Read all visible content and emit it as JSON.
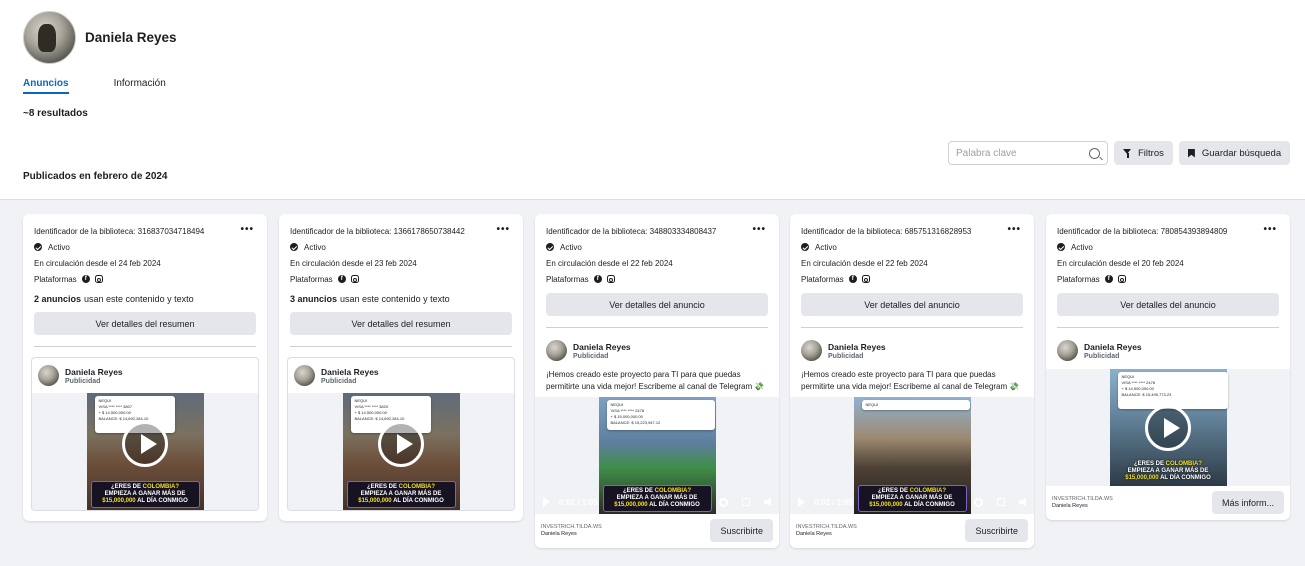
{
  "page": {
    "name": "Daniela Reyes"
  },
  "tabs": [
    {
      "label": "Anuncios",
      "active": true
    },
    {
      "label": "Información",
      "active": false
    }
  ],
  "results": "~8 resultados",
  "toolbar": {
    "search_placeholder": "Palabra clave",
    "filters_label": "Filtros",
    "save_search_label": "Guardar búsqueda"
  },
  "section_title": "Publicados en febrero de 2024",
  "labels": {
    "active": "Activo",
    "platforms": "Plataformas",
    "sponsored": "Publicidad"
  },
  "colors": {
    "accent": "#0a66c2",
    "promo_yellow": "#f3e01a",
    "card_bg": "#ffffff",
    "area_bg": "#f0f2f5"
  },
  "ad_text": "¡Hemos creado este proyecto para TI para que puedas permitirte una vida mejor! Escribeme al canal de Telegram 💸",
  "promo": {
    "line1a": "¿ERES DE ",
    "line1b": "COLOMBIA?",
    "line2": "EMPIEZA A GANAR MÁS DE",
    "amount": "$15,000,000",
    "line3": " AL DÍA CONMIGO"
  },
  "cards": [
    {
      "library_id": "Identificador de la biblioteca: 316837034718494",
      "since": "En circulación desde el 24 feb 2024",
      "multi_count": "2 anuncios",
      "multi_text": "usan este contenido y texto",
      "detail_button": "Ver detalles del resumen",
      "advertiser": "Daniela Reyes",
      "bank": [
        "NEQUI",
        "VISA **** **** 3807",
        "+ $ 14,500,000.00",
        "BALANCE: $ 14,692,284.10"
      ]
    },
    {
      "library_id": "Identificador de la biblioteca: 1366178650738442",
      "since": "En circulación desde el 23 feb 2024",
      "multi_count": "3 anuncios",
      "multi_text": "usan este contenido y texto",
      "detail_button": "Ver detalles del resumen",
      "advertiser": "Daniela Reyes",
      "bank": [
        "NEQUI",
        "VISA **** **** 3820",
        "+ $ 14,500,000.00",
        "BALANCE: $ 14,692,284.10"
      ]
    },
    {
      "library_id": "Identificador de la biblioteca: 348803334808437",
      "since": "En circulación desde el 22 feb 2024",
      "detail_button": "Ver detalles del anuncio",
      "advertiser": "Daniela Reyes",
      "time": "0:02 / 1:05",
      "cta_domain": "INVESTRICH.TILDA.WS",
      "cta_name": "Daniela Reyes",
      "cta_button": "Suscribirte",
      "bank": [
        "NEQUI",
        "VISA **** **** 2478",
        "+ $ 15,000,000.00",
        "BALANCE: $ 15,223,947.12"
      ]
    },
    {
      "library_id": "Identificador de la biblioteca: 685751316828953",
      "since": "En circulación desde el 22 feb 2024",
      "detail_button": "Ver detalles del anuncio",
      "advertiser": "Daniela Reyes",
      "time": "0:02 / 1:05",
      "cta_domain": "INVESTRICH.TILDA.WS",
      "cta_name": "Daniela Reyes",
      "cta_button": "Suscribirte",
      "bank": [
        "NEQUI",
        "VISA **** **** 3478"
      ]
    },
    {
      "library_id": "Identificador de la biblioteca: 780854393894809",
      "since": "En circulación desde el 20 feb 2024",
      "detail_button": "Ver detalles del anuncio",
      "advertiser": "Daniela Reyes",
      "cta_domain": "INVESTRICH.TILDA.WS",
      "cta_name": "Daniela Reyes",
      "cta_button": "Más inform...",
      "bank": [
        "NEQUI",
        "VISA **** **** 2478",
        "+ $ 14,500,000.00",
        "BALANCE: $ 15,495,773.23"
      ]
    }
  ]
}
